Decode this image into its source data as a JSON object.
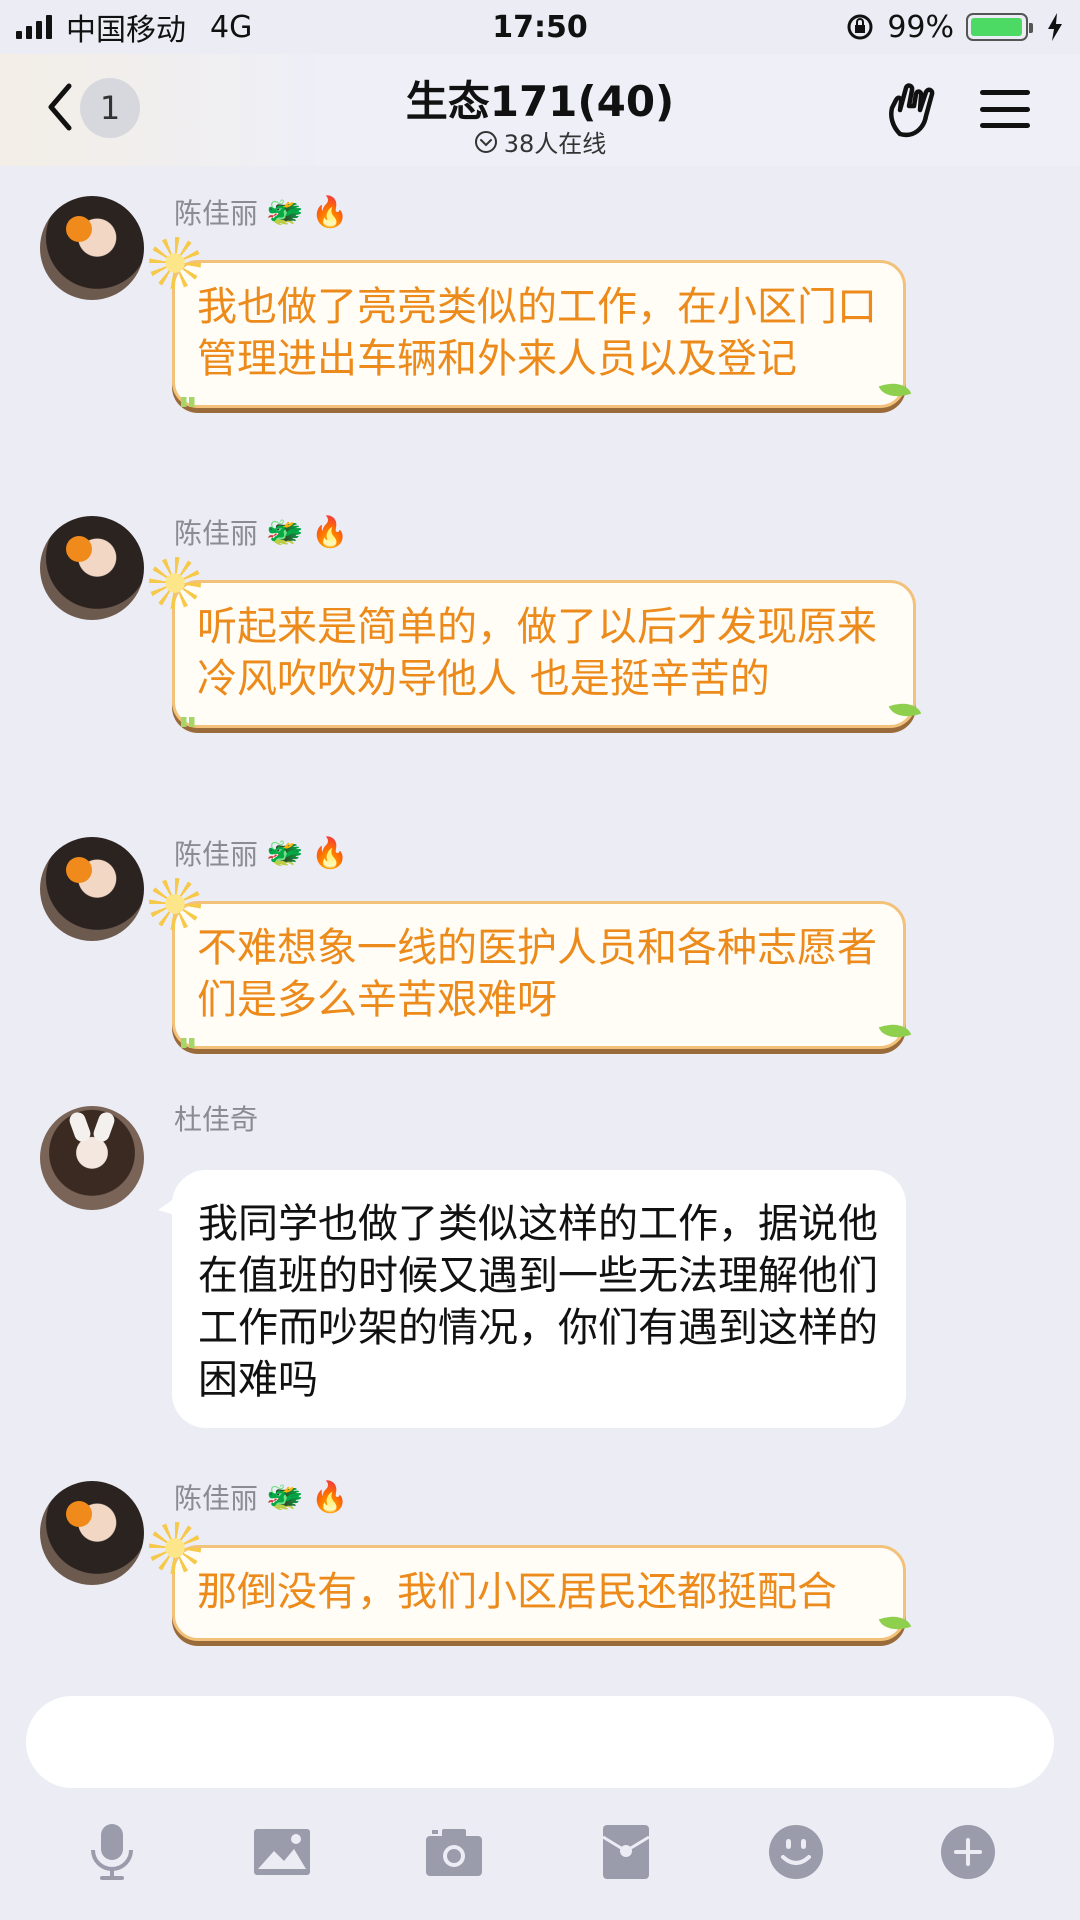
{
  "status_bar": {
    "carrier": "中国移动",
    "network": "4G",
    "time": "17:50",
    "battery": "99%",
    "battery_level": 0.99
  },
  "header": {
    "back_badge": "1",
    "title": "生态171(40)",
    "online": "38人在线"
  },
  "messages": [
    {
      "sender": "陈佳丽",
      "text": "我也做了亮亮类似的工作，在小区门口管理进出车辆和外来人员以及登记",
      "style": "orange"
    },
    {
      "sender": "陈佳丽",
      "text": "听起来是简单的，做了以后才发现原来冷风吹吹劝导他人 也是挺辛苦的",
      "style": "orange"
    },
    {
      "sender": "陈佳丽",
      "text": "不难想象一线的医护人员和各种志愿者们是多么辛苦艰难呀",
      "style": "orange"
    },
    {
      "sender": "杜佳奇",
      "text": "我同学也做了类似这样的工作，据说他在值班的时候又遇到一些无法理解他们工作而吵架的情况，你们有遇到这样的困难吗",
      "style": "white"
    },
    {
      "sender": "陈佳丽",
      "text": "那倒没有，我们小区居民还都挺配合",
      "style": "orange"
    }
  ],
  "input": {
    "placeholder": ""
  },
  "toolbar": {
    "icons": [
      "microphone-icon",
      "image-icon",
      "camera-icon",
      "red-packet-icon",
      "emoji-icon",
      "plus-icon"
    ]
  },
  "colors": {
    "background": "#ebecf4",
    "orange_text": "#ec8b1b",
    "orange_border": "#f2c27a",
    "tool_icon": "#9a9cab",
    "battery": "#4cd964"
  }
}
